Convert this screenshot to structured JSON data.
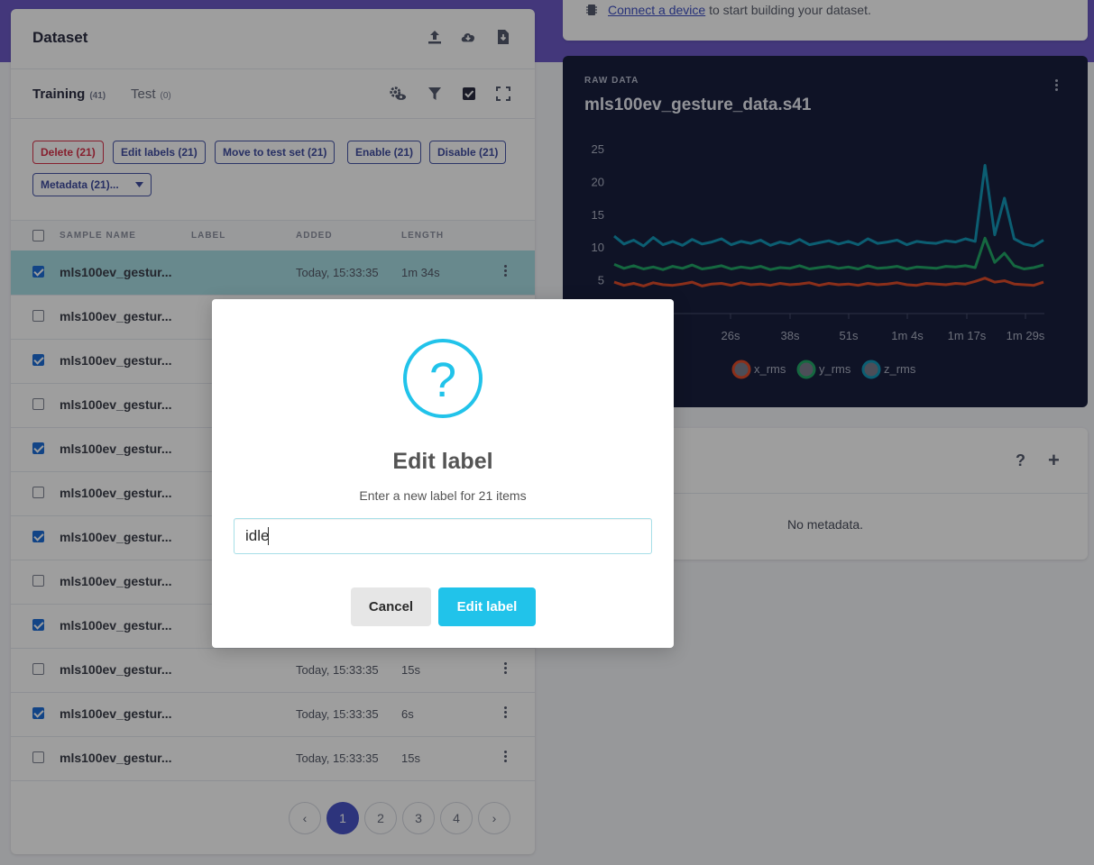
{
  "dataset": {
    "title": "Dataset",
    "tabs": [
      {
        "label": "Training",
        "count": "(41)"
      },
      {
        "label": "Test",
        "count": "(0)"
      }
    ],
    "actions": [
      "Delete (21)",
      "Edit labels (21)",
      "Move to test set (21)",
      "Enable (21)",
      "Disable (21)",
      "Metadata (21)..."
    ],
    "columns": [
      "SAMPLE NAME",
      "LABEL",
      "ADDED",
      "LENGTH"
    ],
    "rows": [
      {
        "name": "mls100ev_gestur...",
        "added": "Today, 15:33:35",
        "length": "1m 34s",
        "checked": true
      },
      {
        "name": "mls100ev_gestur...",
        "added": "",
        "length": "",
        "checked": false
      },
      {
        "name": "mls100ev_gestur...",
        "added": "",
        "length": "",
        "checked": true
      },
      {
        "name": "mls100ev_gestur...",
        "added": "",
        "length": "",
        "checked": false
      },
      {
        "name": "mls100ev_gestur...",
        "added": "",
        "length": "",
        "checked": true
      },
      {
        "name": "mls100ev_gestur...",
        "added": "",
        "length": "",
        "checked": false
      },
      {
        "name": "mls100ev_gestur...",
        "added": "",
        "length": "",
        "checked": true
      },
      {
        "name": "mls100ev_gestur...",
        "added": "",
        "length": "",
        "checked": false
      },
      {
        "name": "mls100ev_gestur...",
        "added": "",
        "length": "",
        "checked": true
      },
      {
        "name": "mls100ev_gestur...",
        "added": "Today, 15:33:35",
        "length": "15s",
        "checked": false
      },
      {
        "name": "mls100ev_gestur...",
        "added": "Today, 15:33:35",
        "length": "6s",
        "checked": true
      },
      {
        "name": "mls100ev_gestur...",
        "added": "Today, 15:33:35",
        "length": "15s",
        "checked": false
      }
    ],
    "pages": [
      "1",
      "2",
      "3",
      "4"
    ],
    "prev_glyph": "‹",
    "next_glyph": "›"
  },
  "device": {
    "link": "Connect a device",
    "rest": " to start building your dataset."
  },
  "raw": {
    "eyebrow": "RAW DATA",
    "title": "mls100ev_gesture_data.s41"
  },
  "metadata": {
    "q": "?",
    "plus": "+",
    "empty": "No metadata."
  },
  "modal": {
    "icon_glyph": "?",
    "title": "Edit label",
    "subtitle": "Enter a new label for 21 items",
    "input_value": "idle",
    "cancel": "Cancel",
    "confirm": "Edit label"
  },
  "colors": {
    "accent": "#21c3ea",
    "topband": "#6c5ac7",
    "x_rms": "#e04d2b",
    "y_rms": "#22a968",
    "z_rms": "#1498b8"
  },
  "chart_data": {
    "type": "line",
    "xticks": [
      "26s",
      "38s",
      "51s",
      "1m 4s",
      "1m 17s",
      "1m 29s"
    ],
    "yticks": [
      5,
      10,
      15,
      20,
      25
    ],
    "ylim": [
      0,
      25
    ],
    "series": [
      {
        "name": "x_rms",
        "values": [
          4.8,
          4.3,
          4.6,
          4.2,
          4.7,
          4.4,
          4.3,
          4.5,
          4.8,
          4.2,
          4.5,
          4.6,
          4.3,
          4.7,
          4.4,
          4.5,
          4.3,
          4.6,
          4.4,
          4.5,
          4.7,
          4.3,
          4.6,
          4.4,
          4.5,
          4.3,
          4.6,
          4.4,
          4.5,
          4.7,
          4.4,
          4.3,
          4.6,
          4.5,
          4.4,
          4.6,
          4.5,
          4.9,
          5.4,
          4.8,
          5.0,
          4.5,
          4.4,
          4.3,
          4.8
        ]
      },
      {
        "name": "y_rms",
        "values": [
          7.5,
          6.9,
          7.3,
          6.8,
          7.1,
          6.7,
          7.2,
          6.9,
          7.4,
          6.8,
          7.0,
          7.3,
          6.8,
          7.1,
          6.9,
          7.2,
          6.7,
          7.0,
          6.9,
          7.3,
          6.8,
          7.0,
          7.2,
          6.9,
          7.1,
          6.8,
          7.3,
          6.9,
          7.0,
          7.2,
          6.8,
          7.1,
          7.0,
          6.9,
          7.2,
          7.1,
          7.3,
          7.0,
          11.5,
          7.8,
          9.2,
          7.3,
          6.8,
          7.0,
          7.4
        ]
      },
      {
        "name": "z_rms",
        "values": [
          11.8,
          10.6,
          11.2,
          10.3,
          11.6,
          10.5,
          11.0,
          10.4,
          11.3,
          10.6,
          10.9,
          11.4,
          10.5,
          11.0,
          10.7,
          11.2,
          10.4,
          10.9,
          10.6,
          11.3,
          10.5,
          10.8,
          11.1,
          10.6,
          11.0,
          10.5,
          11.4,
          10.7,
          10.9,
          11.2,
          10.5,
          11.0,
          10.8,
          10.7,
          11.1,
          10.9,
          11.4,
          11.0,
          22.6,
          12.0,
          17.6,
          11.4,
          10.6,
          10.3,
          11.2
        ]
      }
    ]
  }
}
